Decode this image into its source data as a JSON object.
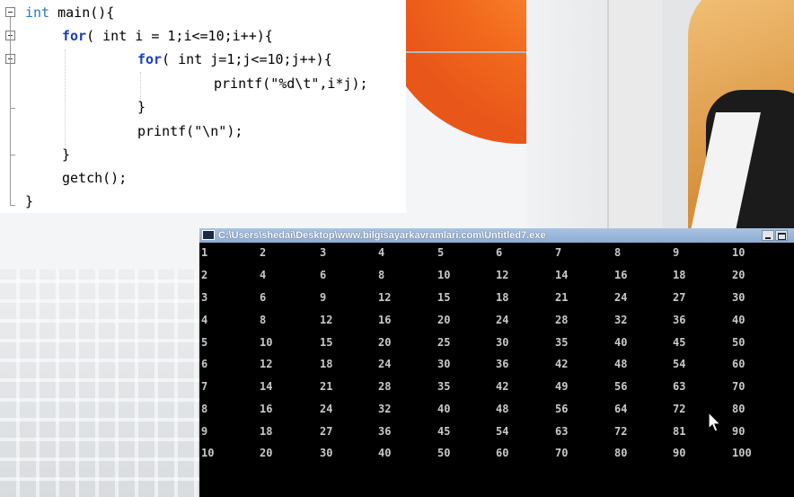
{
  "editor": {
    "lines": [
      {
        "kw": "int",
        "rest": " main(){"
      },
      {
        "kw": "for",
        "rest": "( int i = 1;i<=10;i++){"
      },
      {
        "kw": "for",
        "rest": "( int j=1;j<=10;j++){"
      },
      {
        "text": "printf(\"%d\\t\",i*j);"
      },
      {
        "text": "}"
      },
      {
        "text": "printf(\"\\n\");"
      },
      {
        "text": "}"
      },
      {
        "text": "getch();"
      },
      {
        "text": "}"
      }
    ]
  },
  "console": {
    "title": "C:\\Users\\shedai\\Desktop\\www.bilgisayarkavramlari.com\\Untitled7.exe",
    "rows": [
      [
        "1",
        "2",
        "3",
        "4",
        "5",
        "6",
        "7",
        "8",
        "9",
        "10"
      ],
      [
        "2",
        "4",
        "6",
        "8",
        "10",
        "12",
        "14",
        "16",
        "18",
        "20"
      ],
      [
        "3",
        "6",
        "9",
        "12",
        "15",
        "18",
        "21",
        "24",
        "27",
        "30"
      ],
      [
        "4",
        "8",
        "12",
        "16",
        "20",
        "24",
        "28",
        "32",
        "36",
        "40"
      ],
      [
        "5",
        "10",
        "15",
        "20",
        "25",
        "30",
        "35",
        "40",
        "45",
        "50"
      ],
      [
        "6",
        "12",
        "18",
        "24",
        "30",
        "36",
        "42",
        "48",
        "54",
        "60"
      ],
      [
        "7",
        "14",
        "21",
        "28",
        "35",
        "42",
        "49",
        "56",
        "63",
        "70"
      ],
      [
        "8",
        "16",
        "24",
        "32",
        "40",
        "48",
        "56",
        "64",
        "72",
        "80"
      ],
      [
        "9",
        "18",
        "27",
        "36",
        "45",
        "54",
        "63",
        "72",
        "81",
        "90"
      ],
      [
        "10",
        "20",
        "30",
        "40",
        "50",
        "60",
        "70",
        "80",
        "90",
        "100"
      ]
    ]
  }
}
